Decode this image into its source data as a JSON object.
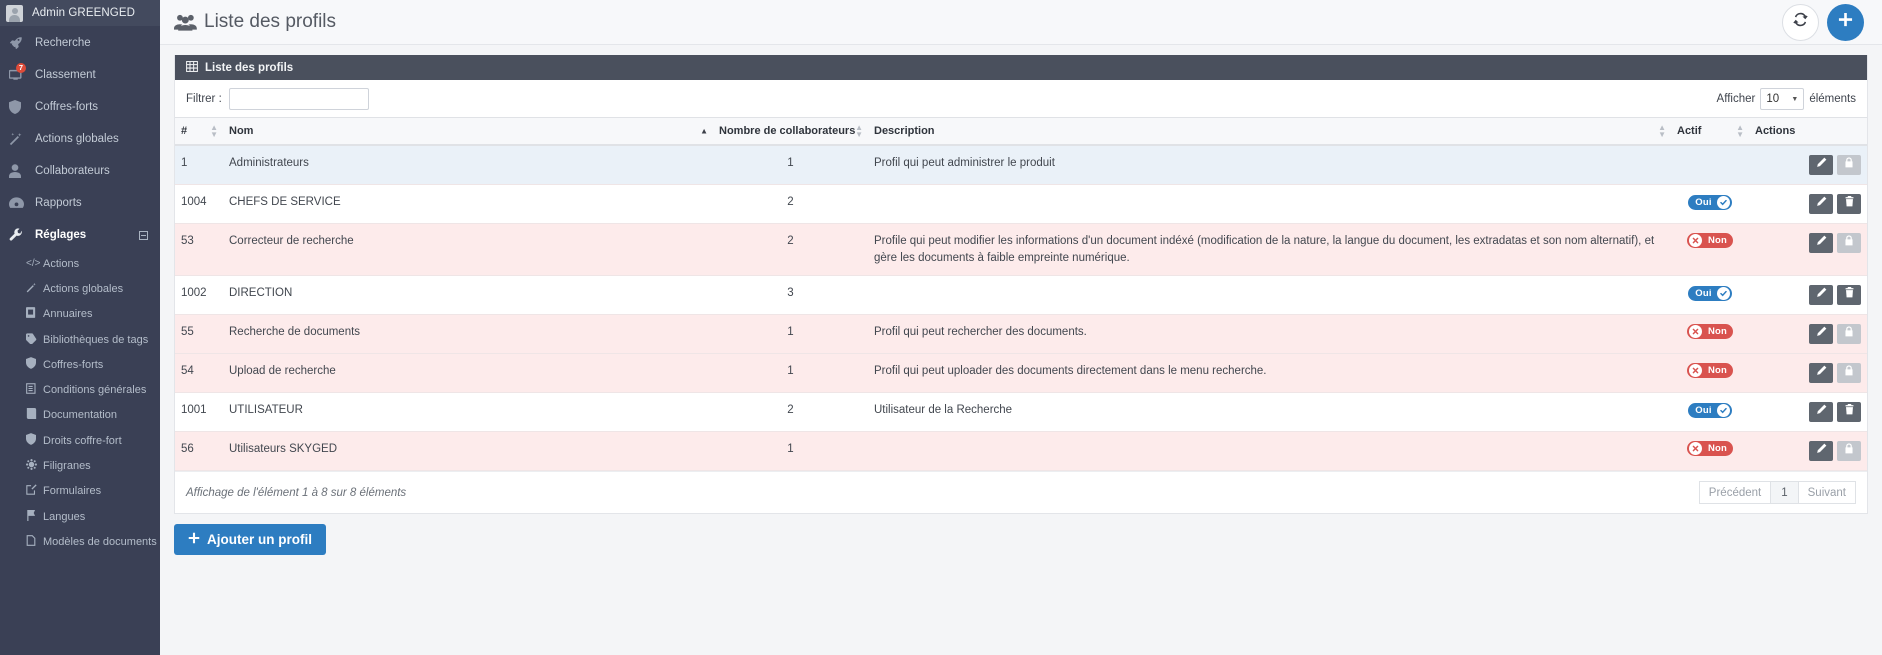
{
  "sidebar": {
    "user": {
      "name": "Admin GREENGED",
      "avatar_icon": "user-avatar-icon"
    },
    "items": [
      {
        "label": "Recherche",
        "icon": "rocket-icon",
        "badge": null,
        "active": false
      },
      {
        "label": "Classement",
        "icon": "monitor-icon",
        "badge": "7",
        "active": false
      },
      {
        "label": "Coffres-forts",
        "icon": "shield-icon",
        "badge": null,
        "active": false
      },
      {
        "label": "Actions globales",
        "icon": "magic-wand-icon",
        "badge": null,
        "active": false
      },
      {
        "label": "Collaborateurs",
        "icon": "user-icon",
        "badge": null,
        "active": false
      },
      {
        "label": "Rapports",
        "icon": "dashboard-icon",
        "badge": null,
        "active": false
      },
      {
        "label": "Réglages",
        "icon": "wrench-icon",
        "badge": null,
        "active": true
      }
    ],
    "sub_items": [
      {
        "label": "Actions",
        "icon": "code-icon"
      },
      {
        "label": "Actions globales",
        "icon": "magic-wand-icon"
      },
      {
        "label": "Annuaires",
        "icon": "address-book-icon"
      },
      {
        "label": "Bibliothèques de tags",
        "icon": "tag-icon"
      },
      {
        "label": "Coffres-forts",
        "icon": "shield-icon"
      },
      {
        "label": "Conditions générales",
        "icon": "list-alt-icon"
      },
      {
        "label": "Documentation",
        "icon": "book-icon"
      },
      {
        "label": "Droits coffre-fort",
        "icon": "shield-icon"
      },
      {
        "label": "Filigranes",
        "icon": "asterisk-icon"
      },
      {
        "label": "Formulaires",
        "icon": "edit-square-icon"
      },
      {
        "label": "Langues",
        "icon": "flag-icon"
      },
      {
        "label": "Modèles de documents",
        "icon": "file-icon"
      }
    ]
  },
  "header": {
    "title": "Liste des profils",
    "title_icon": "people-group-icon",
    "refresh_icon": "refresh-icon",
    "add_icon": "plus-icon"
  },
  "panel": {
    "title": "Liste des profils",
    "icon": "table-grid-icon"
  },
  "controls": {
    "filter_label": "Filtrer :",
    "filter_value": "",
    "filter_placeholder": "",
    "afficher_label": "Afficher",
    "page_size": "10",
    "elements_label": "éléments",
    "caret_icon": "chevron-down-icon"
  },
  "table": {
    "columns": [
      {
        "label": "#",
        "sort": "none"
      },
      {
        "label": "Nom",
        "sort": "asc"
      },
      {
        "label": "Nombre de collaborateurs",
        "sort": "none"
      },
      {
        "label": "Description",
        "sort": "none"
      },
      {
        "label": "Actif",
        "sort": "none"
      },
      {
        "label": "Actions",
        "sort": null
      }
    ],
    "rows": [
      {
        "id": "1",
        "nom": "Administrateurs",
        "nb": "1",
        "description": "Profil qui peut administrer le produit",
        "actif": null,
        "actif_label": "",
        "row_style": "blue",
        "actions": [
          "edit",
          "lock"
        ]
      },
      {
        "id": "1004",
        "nom": "CHEFS DE SERVICE",
        "nb": "2",
        "description": "",
        "actif": "oui",
        "actif_label": "Oui",
        "row_style": "white",
        "actions": [
          "edit",
          "del"
        ]
      },
      {
        "id": "53",
        "nom": "Correcteur de recherche",
        "nb": "2",
        "description": "Profile qui peut modifier les informations d'un document indéxé (modification de la nature, la langue du document, les extradatas et son nom alternatif), et gère les documents à faible empreinte numérique.",
        "actif": "non",
        "actif_label": "Non",
        "row_style": "pink",
        "actions": [
          "edit",
          "lock"
        ]
      },
      {
        "id": "1002",
        "nom": "DIRECTION",
        "nb": "3",
        "description": "",
        "actif": "oui",
        "actif_label": "Oui",
        "row_style": "white",
        "actions": [
          "edit",
          "del"
        ]
      },
      {
        "id": "55",
        "nom": "Recherche de documents",
        "nb": "1",
        "description": "Profil qui peut rechercher des documents.",
        "actif": "non",
        "actif_label": "Non",
        "row_style": "pink",
        "actions": [
          "edit",
          "lock"
        ]
      },
      {
        "id": "54",
        "nom": "Upload de recherche",
        "nb": "1",
        "description": "Profil qui peut uploader des documents directement dans le menu recherche.",
        "actif": "non",
        "actif_label": "Non",
        "row_style": "pink",
        "actions": [
          "edit",
          "lock"
        ]
      },
      {
        "id": "1001",
        "nom": "UTILISATEUR",
        "nb": "2",
        "description": "Utilisateur de la Recherche",
        "actif": "oui",
        "actif_label": "Oui",
        "row_style": "white",
        "actions": [
          "edit",
          "del"
        ]
      },
      {
        "id": "56",
        "nom": "Utilisateurs SKYGED",
        "nb": "1",
        "description": "",
        "actif": "non",
        "actif_label": "Non",
        "row_style": "pink",
        "actions": [
          "edit",
          "lock"
        ]
      }
    ]
  },
  "footer": {
    "info": "Affichage de l'élément 1 à 8 sur 8 éléments",
    "prev": "Précédent",
    "page": "1",
    "next": "Suivant"
  },
  "actions": {
    "add_profile": "Ajouter un profil",
    "add_icon": "plus-icon",
    "edit_icon": "pencil-icon",
    "delete_icon": "trash-icon",
    "lock_icon": "lock-icon"
  },
  "colors": {
    "sidebar_bg": "#3a4055",
    "primary": "#2d7dc1",
    "danger": "#d9534f",
    "panel_head": "#4a505d",
    "row_blue": "#eaf1f8",
    "row_pink": "#fdebeb"
  }
}
